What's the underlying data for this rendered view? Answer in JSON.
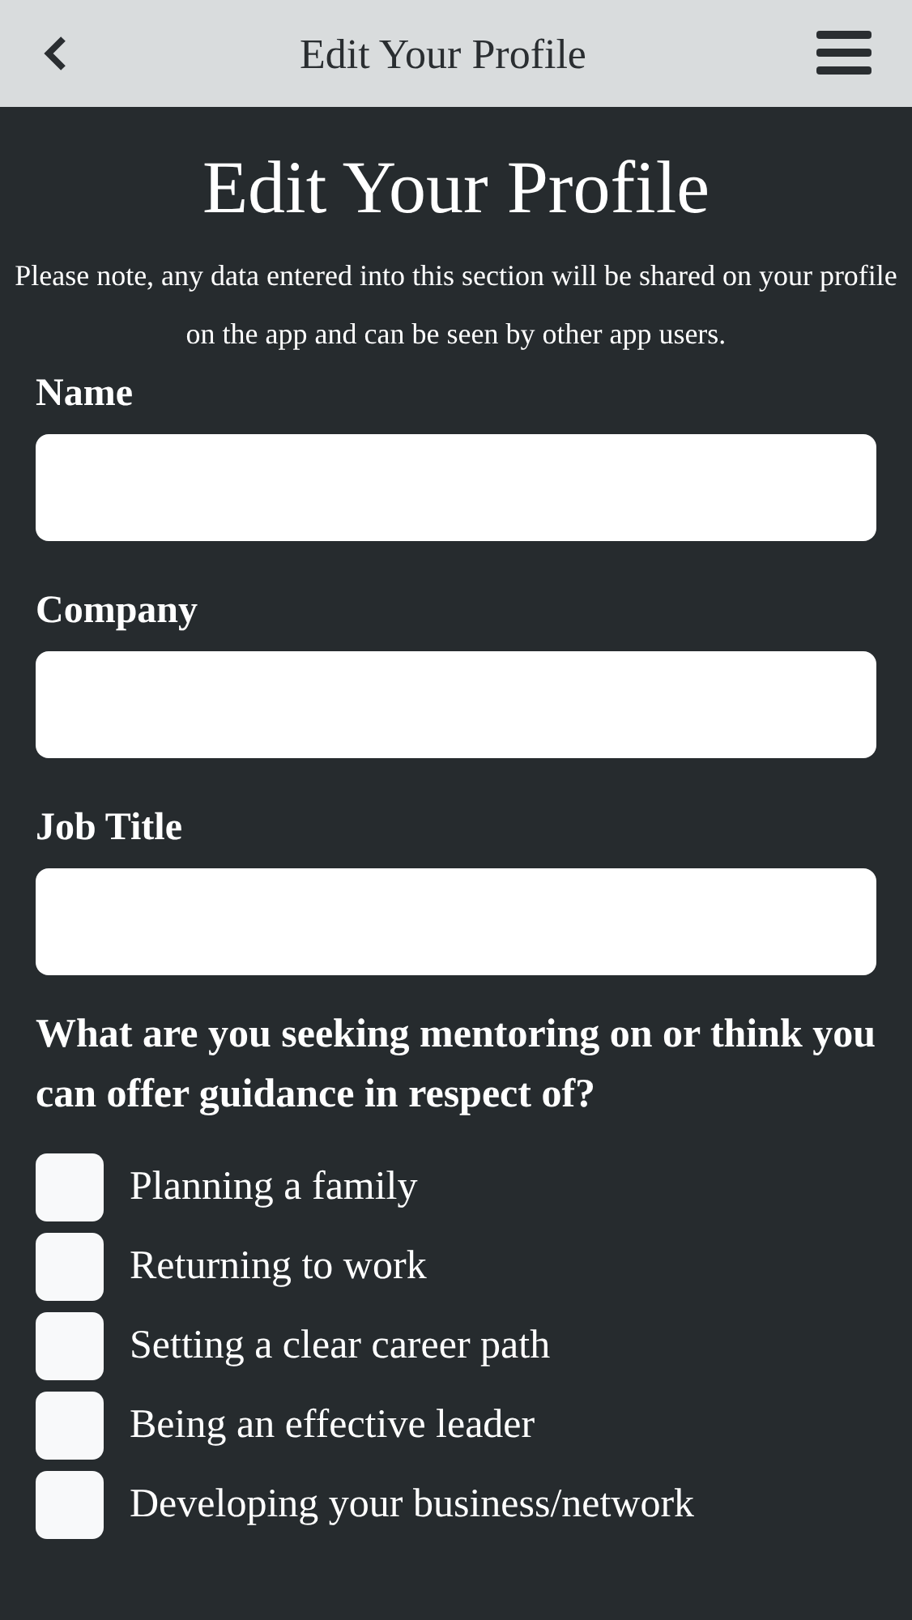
{
  "header": {
    "title": "Edit Your Profile"
  },
  "heading": "Edit Your Profile",
  "note": "Please note, any data entered into this section will be shared on your profile on the app and can be seen by other app users.",
  "fields": [
    {
      "label": "Name"
    },
    {
      "label": "Company"
    },
    {
      "label": "Job Title"
    }
  ],
  "question": "What are you seeking mentoring on or think you can offer guidance in respect of?",
  "options": [
    {
      "label": "Planning a family",
      "checked": false
    },
    {
      "label": "Returning to work",
      "checked": false
    },
    {
      "label": "Setting a clear career path",
      "checked": false
    },
    {
      "label": "Being an effective leader",
      "checked": false
    },
    {
      "label": "Developing your business/network",
      "checked": false
    }
  ]
}
